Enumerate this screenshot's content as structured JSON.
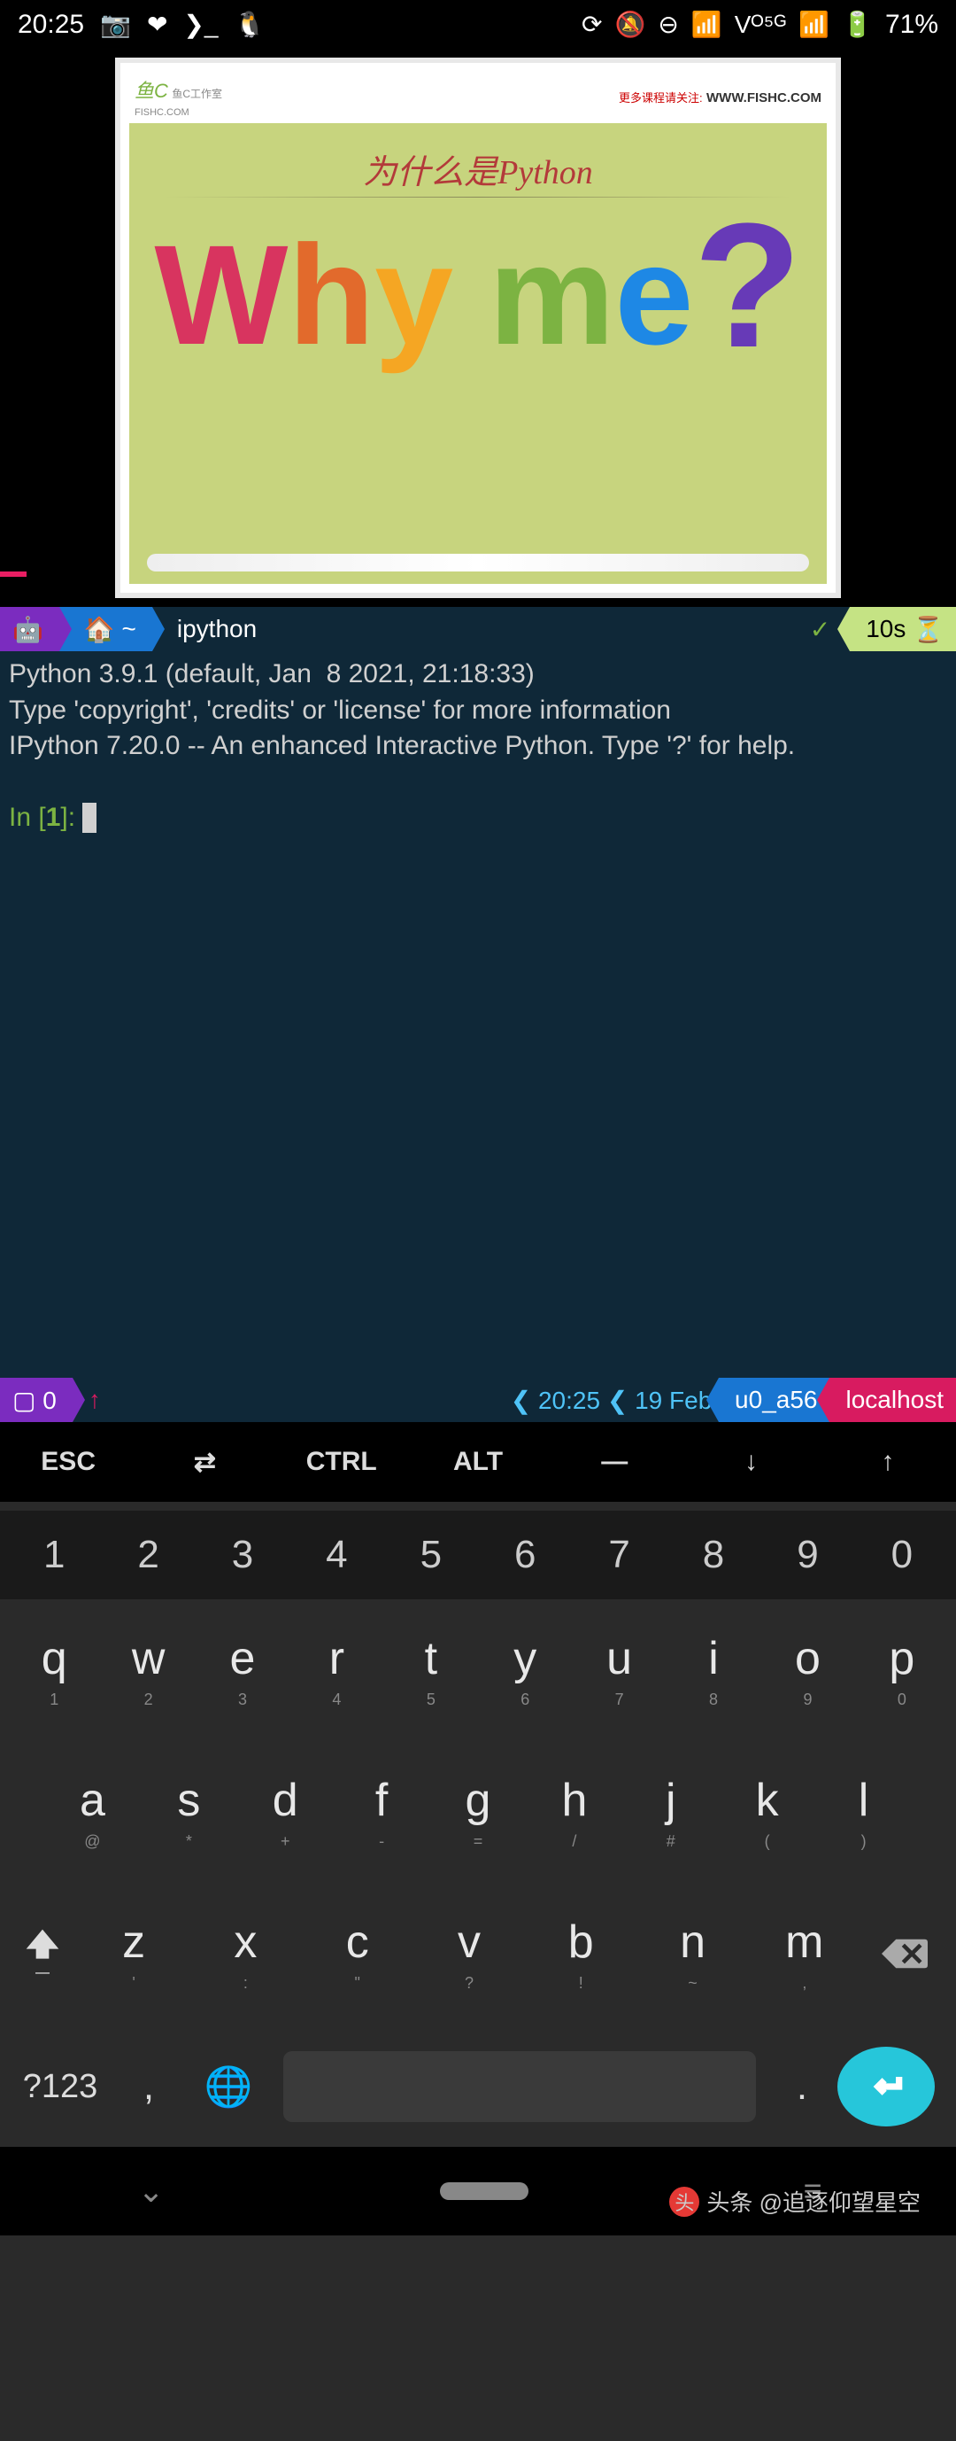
{
  "statusbar": {
    "time": "20:25",
    "battery": "71%"
  },
  "slide": {
    "logo_small": "鱼C工作室",
    "logo_url": "FISHC.COM",
    "more": "更多课程请关注:",
    "url": "WWW.FISHC.COM",
    "title": "为什么是Python",
    "why": [
      "W",
      "h",
      "y",
      " ",
      "m",
      "e",
      "?"
    ]
  },
  "term_hdr": {
    "android": "🤖",
    "home": "🏠",
    "tilde": "~",
    "cmd": "ipython",
    "check": "✓",
    "dur": "10s",
    "hourglass": "⏳"
  },
  "terminal": {
    "l1": "Python 3.9.1 (default, Jan  8 2021, 21:18:33)",
    "l2": "Type 'copyright', 'credits' or 'license' for more information",
    "l3": "IPython 7.20.0 -- An enhanced Interactive Python. Type '?' for help.",
    "in": "In [",
    "n": "1",
    "inb": "]: "
  },
  "botbar": {
    "box": "▢ 0",
    "arrow": "↑",
    "time": "20:25",
    "date": "19 Feb",
    "user": "u0_a56",
    "host": "localhost"
  },
  "extra": [
    "ESC",
    "⇄",
    "CTRL",
    "ALT",
    "―",
    "↓",
    "↑"
  ],
  "numrow": [
    "1",
    "2",
    "3",
    "4",
    "5",
    "6",
    "7",
    "8",
    "9",
    "0"
  ],
  "row1": [
    {
      "k": "q",
      "s": "1"
    },
    {
      "k": "w",
      "s": "2"
    },
    {
      "k": "e",
      "s": "3"
    },
    {
      "k": "r",
      "s": "4"
    },
    {
      "k": "t",
      "s": "5"
    },
    {
      "k": "y",
      "s": "6"
    },
    {
      "k": "u",
      "s": "7"
    },
    {
      "k": "i",
      "s": "8"
    },
    {
      "k": "o",
      "s": "9"
    },
    {
      "k": "p",
      "s": "0"
    }
  ],
  "row2": [
    {
      "k": "a",
      "s": "@"
    },
    {
      "k": "s",
      "s": "*"
    },
    {
      "k": "d",
      "s": "+"
    },
    {
      "k": "f",
      "s": "-"
    },
    {
      "k": "g",
      "s": "="
    },
    {
      "k": "h",
      "s": "/"
    },
    {
      "k": "j",
      "s": "#"
    },
    {
      "k": "k",
      "s": "("
    },
    {
      "k": "l",
      "s": ")"
    }
  ],
  "row3": [
    {
      "k": "z",
      "s": "'"
    },
    {
      "k": "x",
      "s": ":"
    },
    {
      "k": "c",
      "s": "\""
    },
    {
      "k": "v",
      "s": "?"
    },
    {
      "k": "b",
      "s": "!"
    },
    {
      "k": "n",
      "s": "~"
    },
    {
      "k": "m",
      "s": ","
    }
  ],
  "bot": {
    "sym": "?123",
    "comma": ",",
    "dot": "."
  },
  "shift_underscore": "—",
  "watermark": "头条 @追逐仰望星空"
}
